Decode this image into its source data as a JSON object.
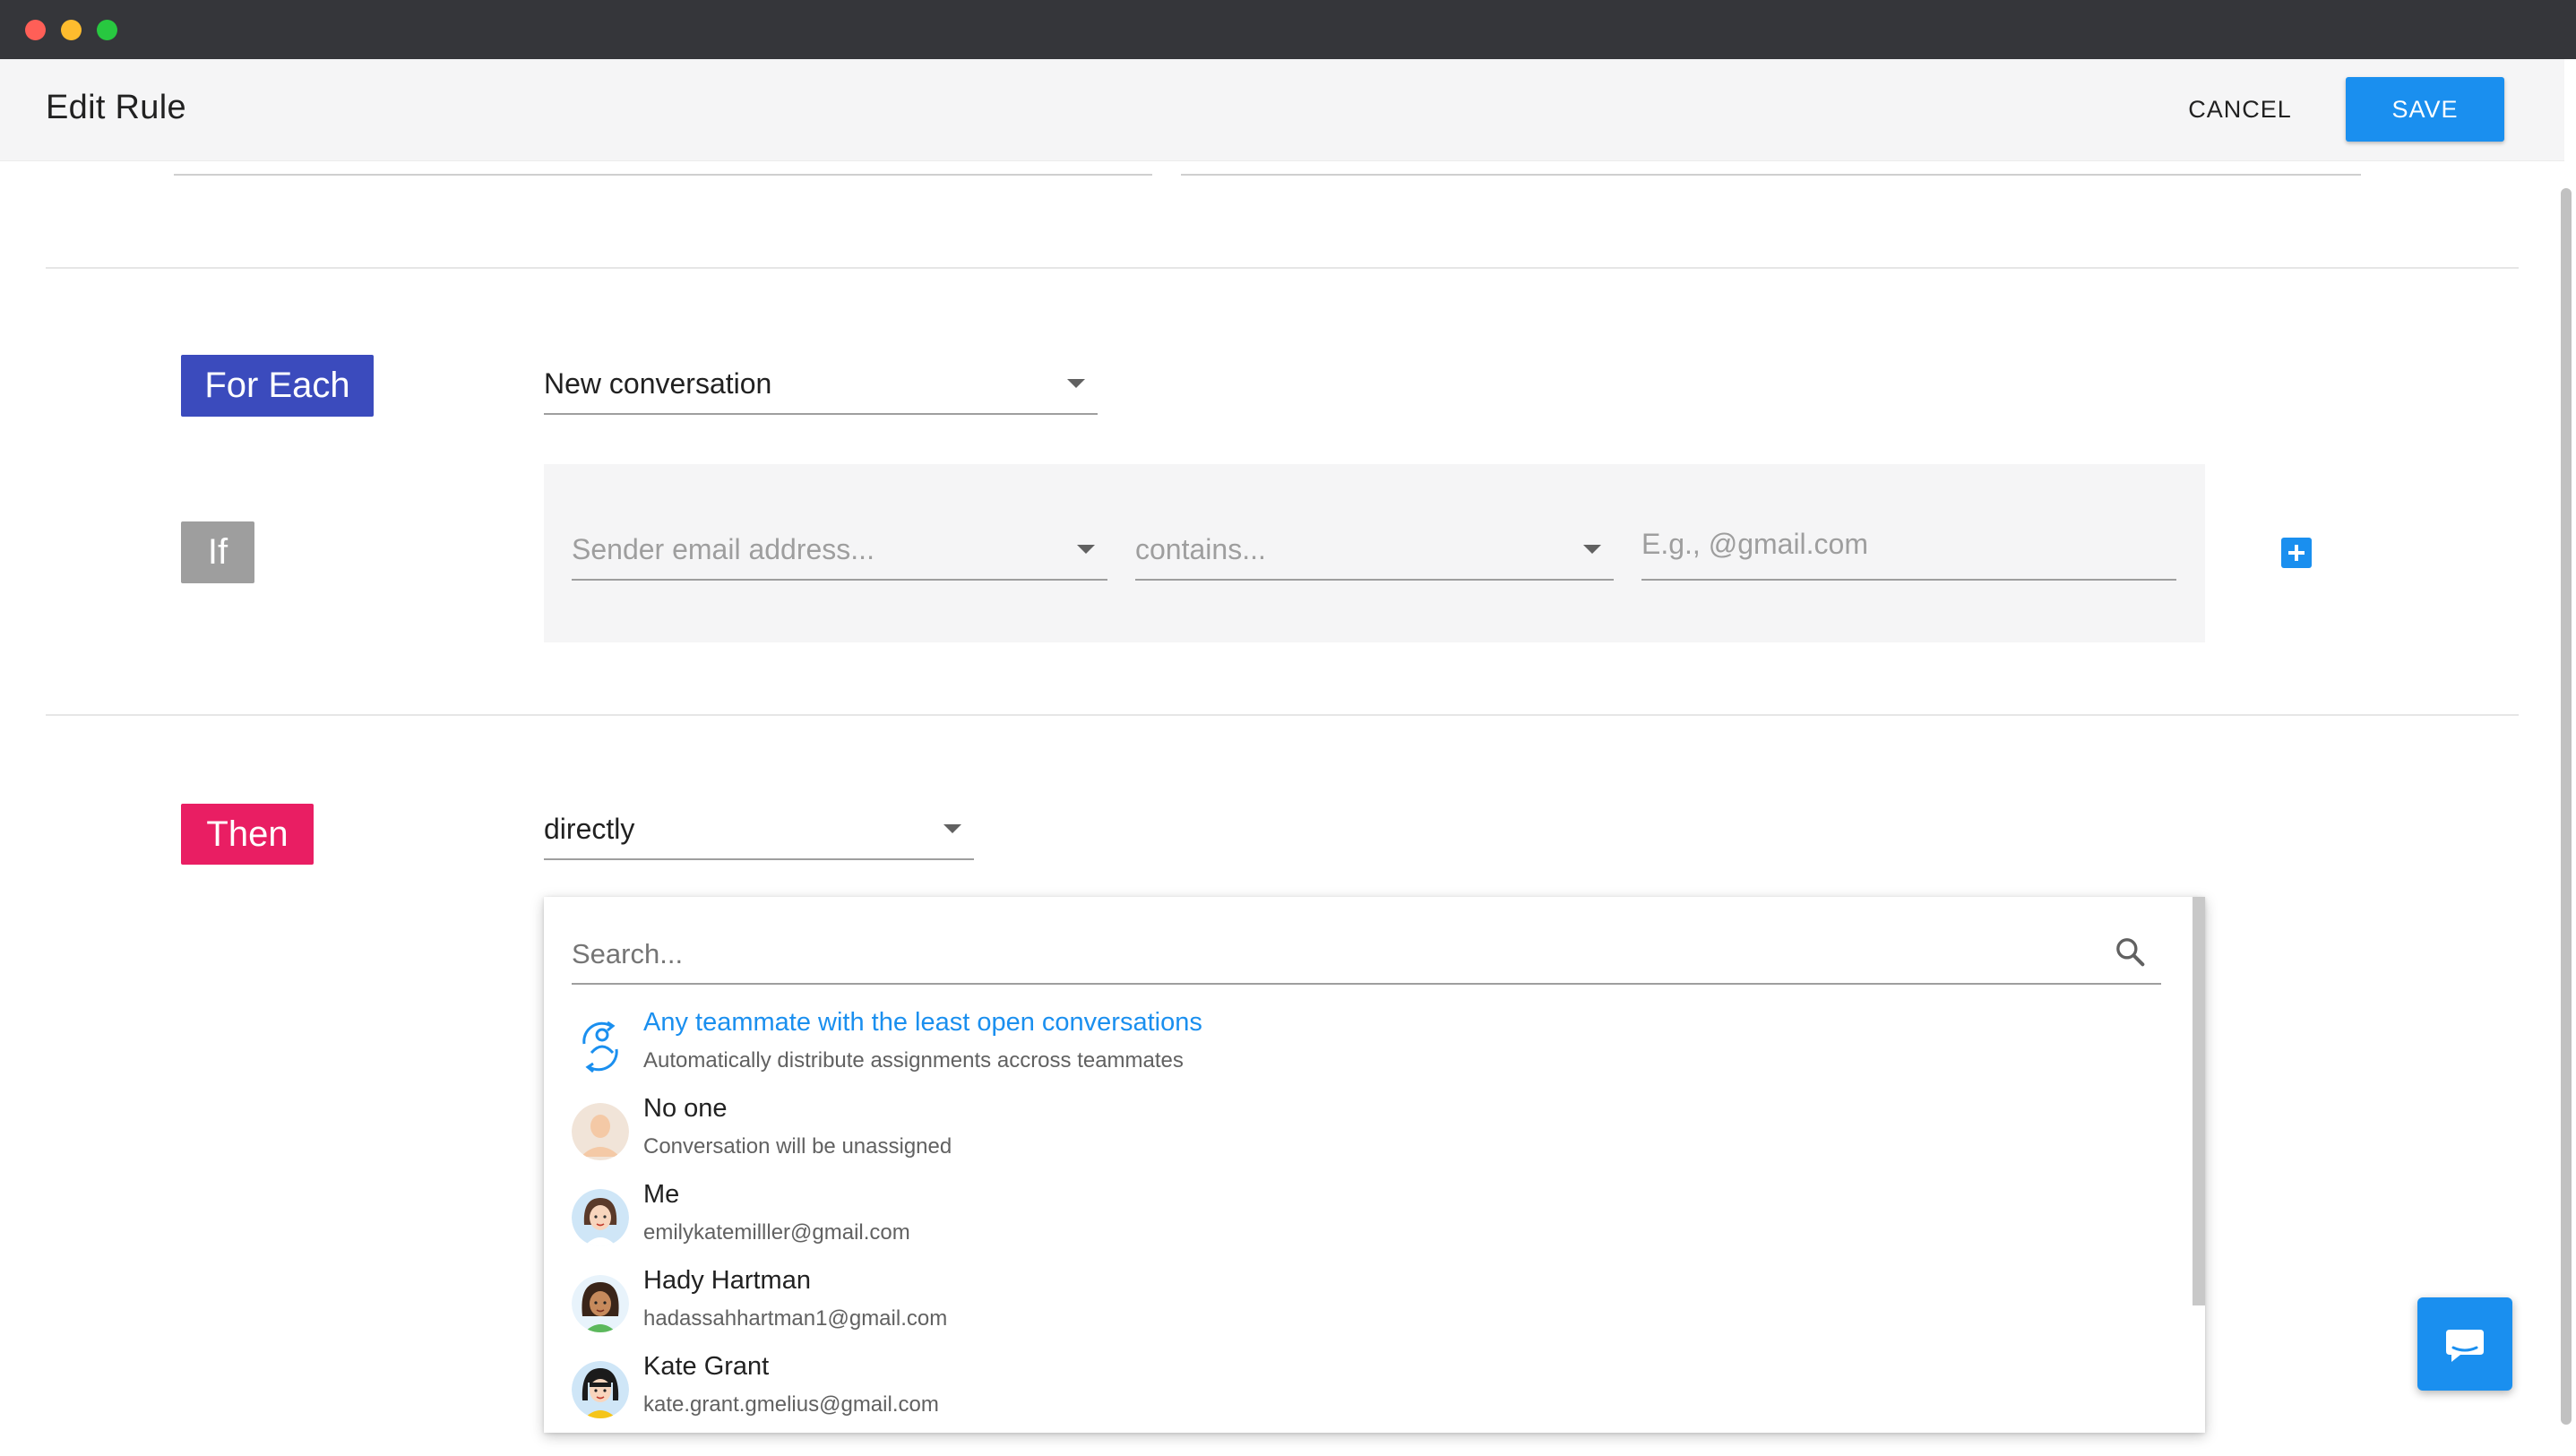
{
  "header": {
    "title": "Edit Rule",
    "cancel_label": "CANCEL",
    "save_label": "SAVE"
  },
  "rule": {
    "for_each": {
      "tag": "For Each",
      "selected": "New conversation"
    },
    "if": {
      "tag": "If",
      "field_placeholder": "Sender email address...",
      "operator_placeholder": "contains...",
      "value_placeholder": "E.g., @gmail.com"
    },
    "then": {
      "tag": "Then",
      "selected": "directly"
    }
  },
  "assign_dropdown": {
    "search_placeholder": "Search...",
    "options": [
      {
        "title": "Any teammate with the least open conversations",
        "subtitle": "Automatically distribute assignments accross teammates",
        "icon": "round-robin-icon"
      },
      {
        "title": "No one",
        "subtitle": "Conversation will be unassigned",
        "icon": "blank-avatar"
      },
      {
        "title": "Me",
        "subtitle": "emilykatemilller@gmail.com",
        "icon": "avatar"
      },
      {
        "title": "Hady Hartman",
        "subtitle": "hadassahhartman1@gmail.com",
        "icon": "avatar"
      },
      {
        "title": "Kate Grant",
        "subtitle": "kate.grant.gmelius@gmail.com",
        "icon": "avatar"
      }
    ]
  },
  "colors": {
    "primary": "#1a8fef",
    "for_each_tag": "#3b4bbd",
    "if_tag": "#9e9e9e",
    "then_tag": "#e91e63"
  }
}
